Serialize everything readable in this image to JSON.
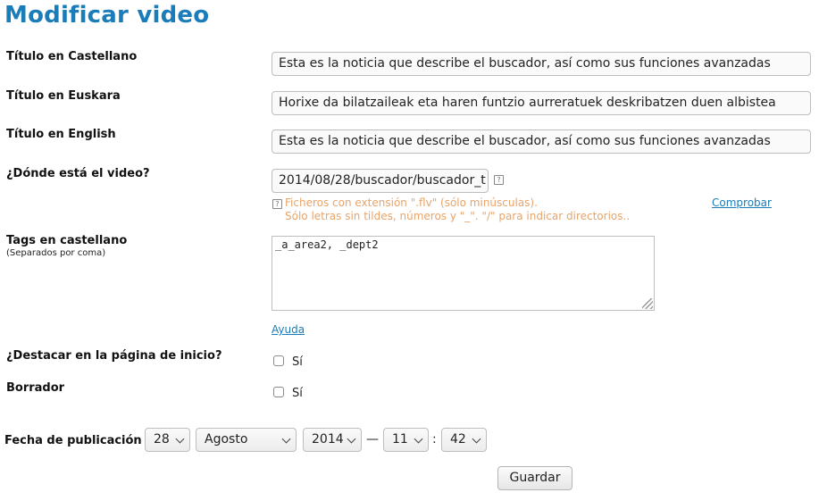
{
  "page": {
    "title": "Modificar video"
  },
  "form": {
    "titulo_castellano": {
      "label": "Título en Castellano",
      "value": "Esta es la noticia que describe el buscador, así como sus funciones avanzadas"
    },
    "titulo_euskara": {
      "label": "Título en Euskara",
      "value": "Horixe da bilatzaileak eta haren funtzio aurreratuek deskribatzen duen albistea"
    },
    "titulo_english": {
      "label": "Título en English",
      "value": "Esta es la noticia que describe el buscador, así como sus funciones avanzadas"
    },
    "video": {
      "label": "¿Dónde está el video?",
      "value": "2014/08/28/buscador/buscador_t",
      "hint_line1": "Ficheros con extensión \".flv\" (sólo minúsculas).",
      "hint_line2": "Sólo letras sin tildes, números y \"_\". \"/\" para indicar directorios..",
      "check_link": "Comprobar",
      "help_glyph": "?"
    },
    "tags": {
      "label": "Tags en castellano",
      "sublabel": "(Separados por coma)",
      "value": "_a_area2, _dept2",
      "help_link": "Ayuda"
    },
    "destacar": {
      "label": "¿Destacar en la página de inicio?",
      "option": "Sí",
      "checked": false
    },
    "borrador": {
      "label": "Borrador",
      "option": "Sí",
      "checked": false
    },
    "fecha": {
      "label": "Fecha de publicación",
      "day": "28",
      "month": "Agosto",
      "year": "2014",
      "dash": "—",
      "hour": "11",
      "colon": ":",
      "minute": "42"
    },
    "save_label": "Guardar"
  }
}
